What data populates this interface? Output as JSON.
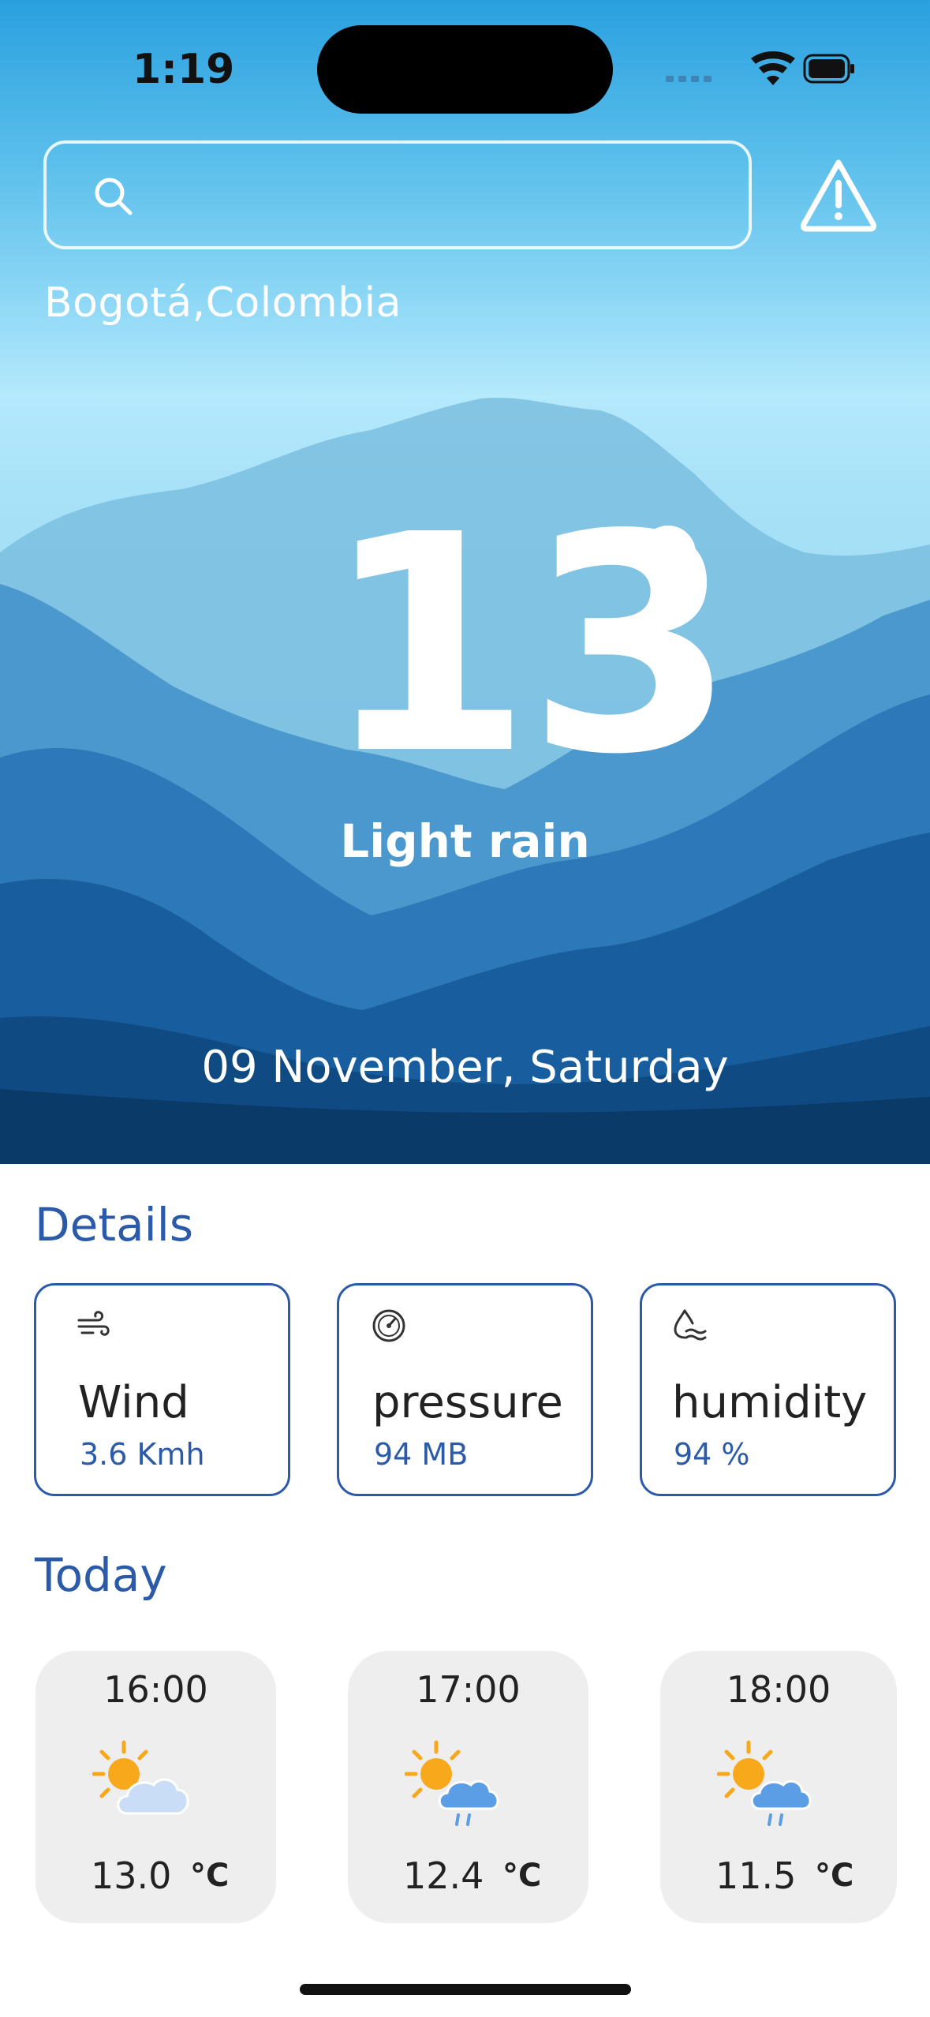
{
  "status_bar": {
    "time": "1:19"
  },
  "search": {
    "placeholder": ""
  },
  "location": "Bogotá,Colombia",
  "current": {
    "temperature": "13",
    "condition": "Light rain",
    "date": "09 November, Saturday"
  },
  "details": {
    "title": "Details",
    "items": [
      {
        "label": "Wind",
        "value": "3.6 Kmh",
        "icon": "wind-icon"
      },
      {
        "label": "pressure",
        "value": "94 MB",
        "icon": "gauge-icon"
      },
      {
        "label": "humidity",
        "value": "94 %",
        "icon": "humidity-icon"
      }
    ]
  },
  "today": {
    "title": "Today",
    "hours": [
      {
        "time": "16:00",
        "temp": "13.0",
        "unit": "°C",
        "icon": "partly-cloudy-icon"
      },
      {
        "time": "17:00",
        "temp": "12.4",
        "unit": "°C",
        "icon": "sun-rain-icon"
      },
      {
        "time": "18:00",
        "temp": "11.5",
        "unit": "°C",
        "icon": "sun-rain-icon"
      }
    ]
  },
  "colors": {
    "accent": "#2a5aa8",
    "card_bg": "#eeeeee",
    "sun": "#f8a91b"
  }
}
